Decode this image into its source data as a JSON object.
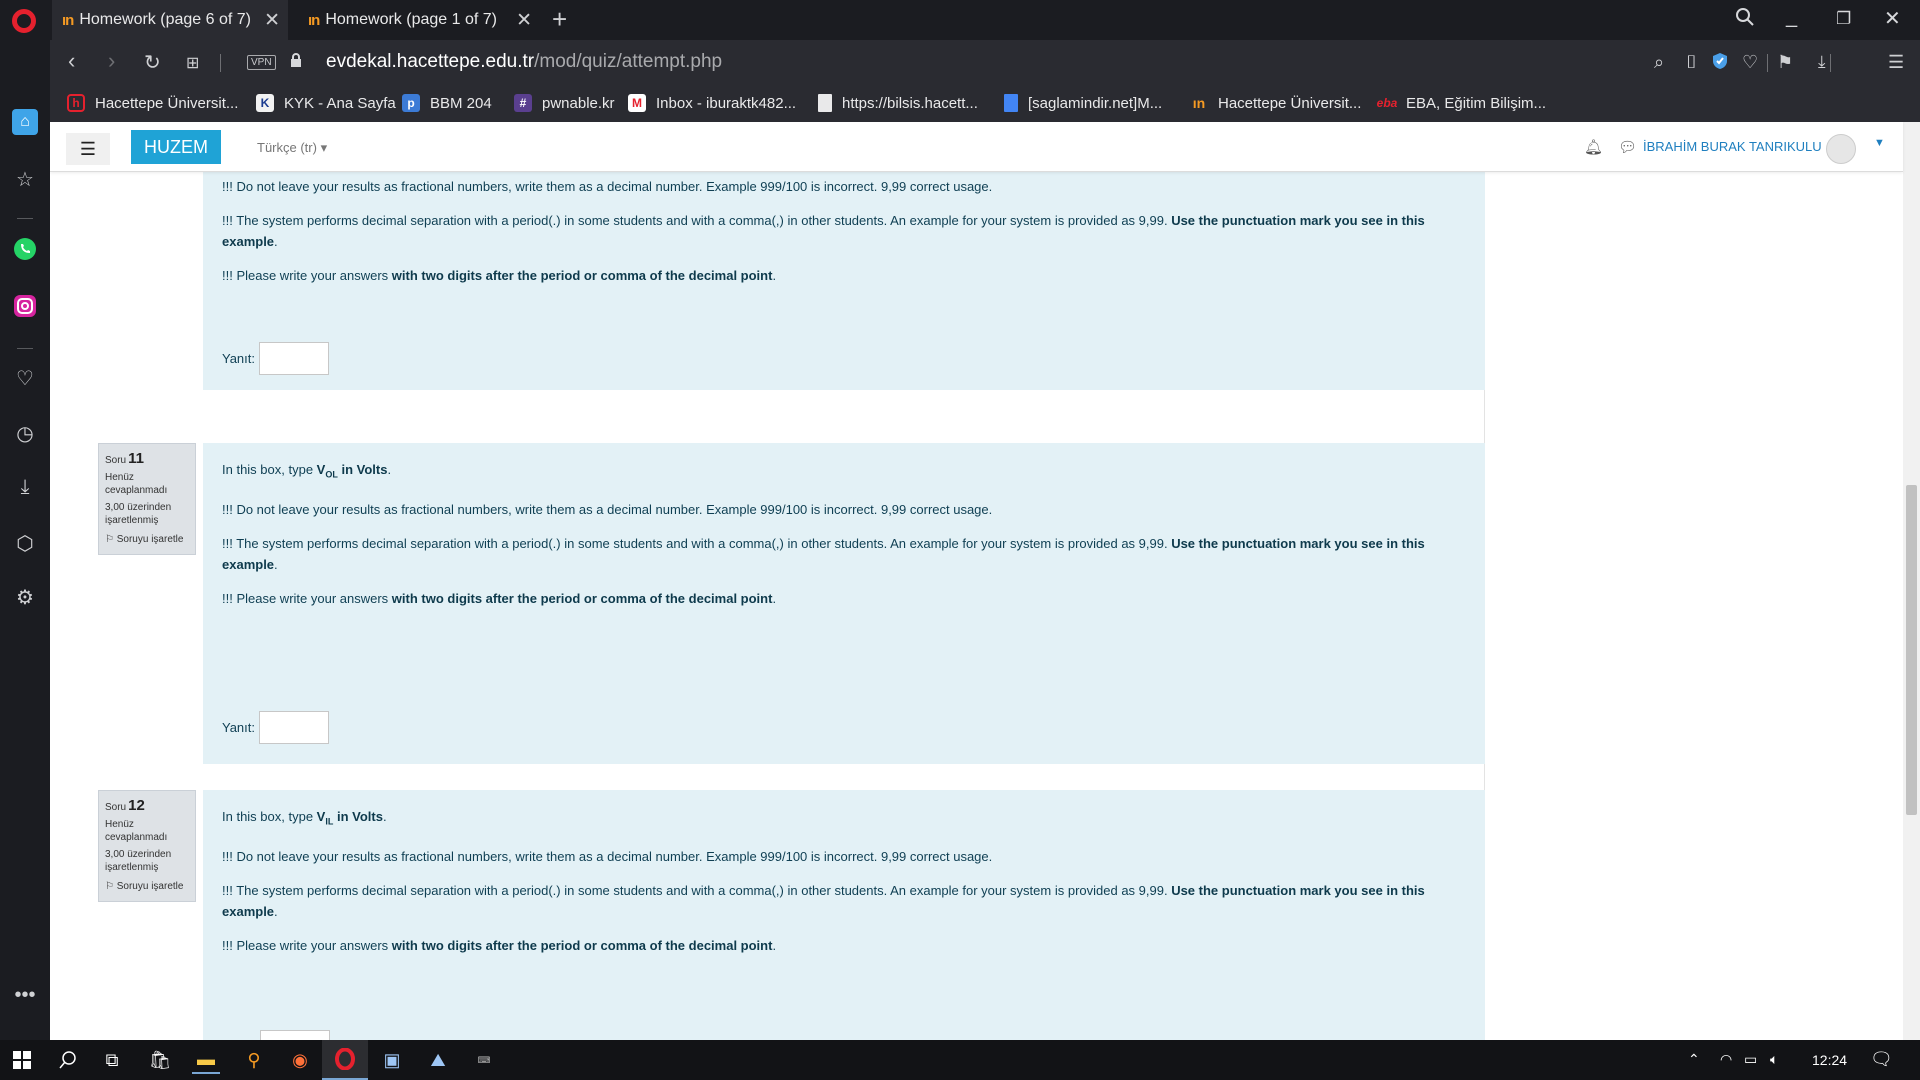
{
  "browser": {
    "tabs": [
      {
        "label": "Homework (page 6 of 7)",
        "active": true
      },
      {
        "label": "Homework (page 1 of 7)",
        "active": false
      }
    ],
    "vpn_label": "VPN",
    "url_host": "evdekal.hacettepe.edu.tr",
    "url_prefix": "",
    "url_path": "/mod/quiz/attempt.php",
    "bookmarks": [
      {
        "label": "Hacettepe Üniversit...",
        "icon": "hacettepe-icon",
        "color": "#e5212e"
      },
      {
        "label": "KYK - Ana Sayfa",
        "icon": "kyk-icon",
        "color": "#ffffff"
      },
      {
        "label": "BBM 204",
        "icon": "piazza-icon",
        "color": "#3c7bd6"
      },
      {
        "label": "pwnable.kr",
        "icon": "slack-hash-icon",
        "color": "#5a3f8f"
      },
      {
        "label": "Inbox - iburaktk482...",
        "icon": "gmail-icon",
        "color": "#e5212e"
      },
      {
        "label": "https://bilsis.hacett...",
        "icon": "document-icon",
        "color": "#e9e9ea"
      },
      {
        "label": "[saglamindir.net]M...",
        "icon": "gdocs-icon",
        "color": "#4285f4"
      },
      {
        "label": "Hacettepe Üniversit...",
        "icon": "moodle-icon",
        "color": "#f59a23"
      },
      {
        "label": "EBA, Eğitim Bilişim...",
        "icon": "eba-icon",
        "color": "#e5212e"
      }
    ]
  },
  "site": {
    "brand": "HUZEM",
    "language": "Türkçe (tr)",
    "user_name": "İBRAHİM BURAK TANRIKULU"
  },
  "question_prev": {
    "note1": "!!! Do not leave your results as fractional numbers, write them as a decimal number. Example 999/100 is incorrect. 9,99 correct usage.",
    "note2_plain": "!!! The system performs decimal separation with a period(.) in some students and with a comma(,) in other students. An example for your system is provided as 9,99. ",
    "note2_bold": "Use the punctuation mark you see in this example",
    "note3_plain": "!!! Please write your answers ",
    "note3_bold": "with two digits after the period or comma of the decimal point",
    "answer_label": "Yanıt:"
  },
  "questions": [
    {
      "soru_label": "Soru",
      "number": "11",
      "state": "Henüz cevaplanmadı",
      "marks": "3,00 üzerinden işaretlenmiş",
      "flag_label": "Soruyu işaretle",
      "intro_plain": "In this box, type ",
      "intro_var": "V",
      "intro_sub": "OL",
      "intro_tail": " in Volts",
      "note1": "!!! Do not leave your results as fractional numbers, write them as a decimal number. Example 999/100 is incorrect. 9,99 correct usage.",
      "note2_plain": "!!! The system performs decimal separation with a period(.) in some students and with a comma(,) in other students. An example for your system is provided as 9,99. ",
      "note2_bold": "Use the punctuation mark you see in this example",
      "note3_plain": "!!! Please write your answers ",
      "note3_bold": "with two digits after the period or comma of the decimal point",
      "answer_label": "Yanıt:"
    },
    {
      "soru_label": "Soru",
      "number": "12",
      "state": "Henüz cevaplanmadı",
      "marks": "3,00 üzerinden işaretlenmiş",
      "flag_label": "Soruyu işaretle",
      "intro_plain": "In this box, type ",
      "intro_var": "V",
      "intro_sub": "IL",
      "intro_tail": " in Volts",
      "note1": "!!! Do not leave your results as fractional numbers, write them as a decimal number. Example 999/100 is incorrect. 9,99 correct usage.",
      "note2_plain": "!!! The system performs decimal separation with a period(.) in some students and with a comma(,) in other students. An example for your system is provided as 9,99. ",
      "note2_bold": "Use the punctuation mark you see in this example",
      "note3_plain": "!!! Please write your answers ",
      "note3_bold": "with two digits after the period or comma of the decimal point"
    }
  ],
  "taskbar": {
    "clock": "12:24"
  }
}
